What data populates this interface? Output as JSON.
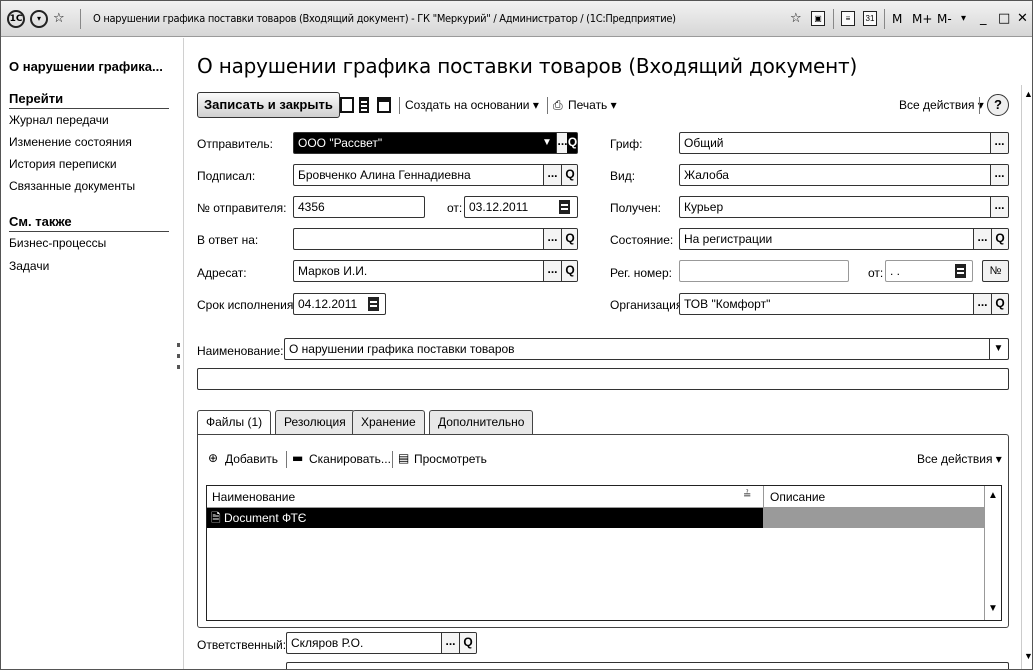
{
  "window": {
    "title": "О нарушении графика поставки товаров (Входящий документ) - ГК \"Меркурий\" / Администратор / (1С:Предприятие)",
    "logo_text": "1С",
    "m_buttons": [
      "M",
      "M+",
      "M-"
    ],
    "minimize": "_",
    "restore": "□",
    "close": "✕"
  },
  "left_panel": {
    "title": "О нарушении графика...",
    "goto_heading": "Перейти",
    "goto_items": [
      "Журнал передачи",
      "Изменение состояния",
      "История переписки",
      "Связанные документы"
    ],
    "see_also_heading": "См. также",
    "see_also_items": [
      "Бизнес-процессы",
      "Задачи"
    ]
  },
  "form": {
    "title": "О нарушении графика поставки товаров (Входящий документ)",
    "toolbar": {
      "save_close": "Записать и закрыть",
      "create_based": "Создать на основании ▾",
      "print": "Печать ▾",
      "all_actions": "Все действия ▾",
      "help": "?"
    },
    "fields": {
      "sender_label": "Отправитель:",
      "sender_value": "ООО \"Рассвет\"",
      "signed_label": "Подписал:",
      "signed_value": "Бровченко Алина Геннадиевна",
      "sender_no_label": "№ отправителя:",
      "sender_no_value": "4356",
      "from_label": "от:",
      "sender_date": "03.12.2011",
      "reply_label": "В ответ на:",
      "reply_value": "",
      "addressee_label": "Адресат:",
      "addressee_value": "Марков И.И.",
      "deadline_label": "Срок исполнения:",
      "deadline_value": "04.12.2011",
      "grif_label": "Гриф:",
      "grif_value": "Общий",
      "kind_label": "Вид:",
      "kind_value": "Жалоба",
      "received_label": "Получен:",
      "received_value": "Курьер",
      "state_label": "Состояние:",
      "state_value": "На регистрации",
      "regno_label": "Рег. номер:",
      "regno_value": "",
      "reg_from_label": "от:",
      "reg_date": " .  .",
      "no_button": "№",
      "org_label": "Организация:",
      "org_value": "ТОВ \"Комфорт\"",
      "name_label": "Наименование:",
      "name_value": "О нарушении графика поставки товаров",
      "comment_value": "",
      "responsible_label": "Ответственный:",
      "responsible_value": "Скляров Р.О."
    },
    "tabs": [
      "Файлы (1)",
      "Резолюция",
      "Хранение",
      "Дополнительно"
    ],
    "files": {
      "add": "Добавить",
      "scan": "Сканировать...",
      "view": "Просмотреть",
      "all_actions": "Все действия ▾",
      "columns": [
        "Наименование",
        "Описание"
      ],
      "rows": [
        {
          "name": "Document ФТЄ",
          "description": ""
        }
      ]
    }
  }
}
